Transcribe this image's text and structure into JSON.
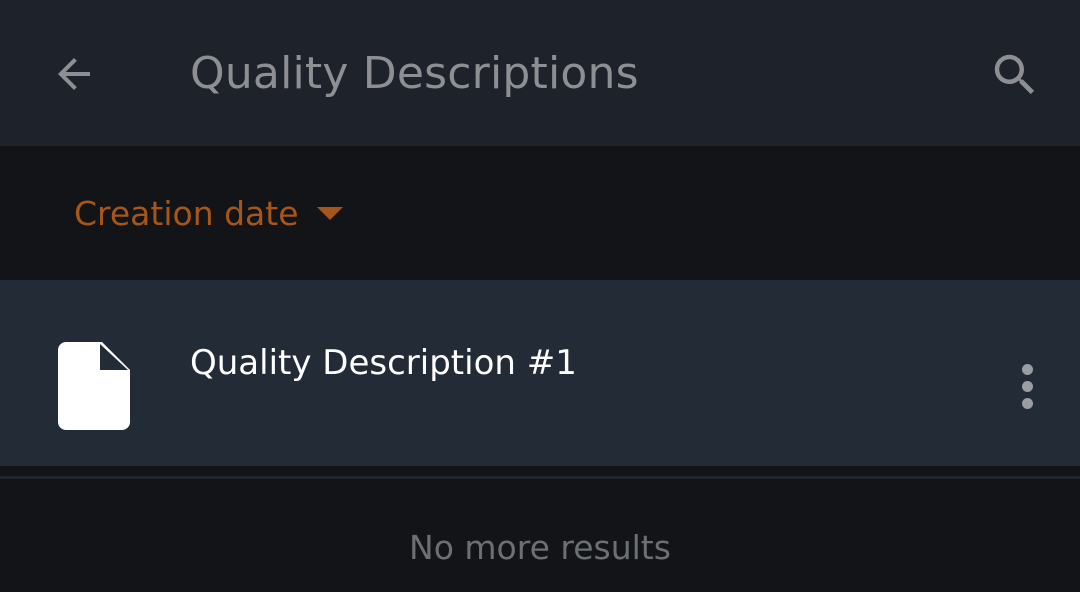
{
  "header": {
    "title": "Quality Descriptions",
    "back_icon": "arrow-left-icon",
    "search_icon": "search-icon"
  },
  "sort": {
    "label": "Creation date",
    "caret_icon": "caret-down-icon"
  },
  "list": {
    "items": [
      {
        "title": "Quality Description #1",
        "icon": "file-icon",
        "menu_icon": "more-vertical-icon"
      }
    ],
    "footer": "No more results"
  },
  "colors": {
    "topbar_bg": "#1e222a",
    "page_bg": "#121417",
    "list_item_bg": "#232c36",
    "accent": "#c0621a",
    "title_text": "#8d8f92",
    "item_text": "#ffffff",
    "footer_text": "#6c6f73"
  }
}
